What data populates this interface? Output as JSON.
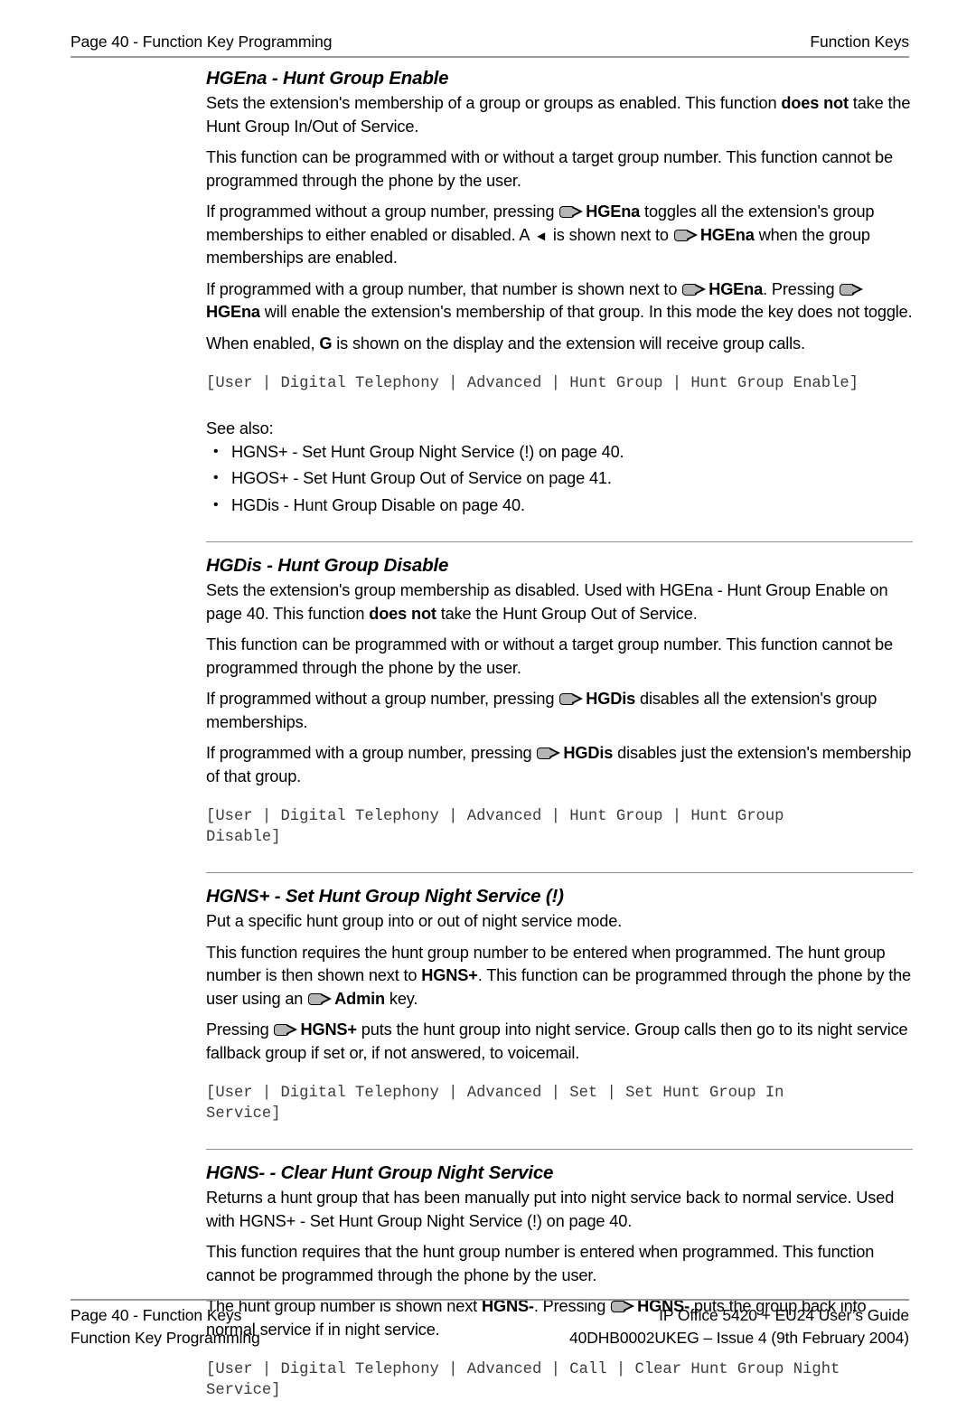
{
  "header": {
    "left": "Page 40 - Function Key Programming",
    "right": "Function Keys"
  },
  "sections": [
    {
      "title": "HGEna - Hunt Group Enable",
      "paras": [
        {
          "runs": [
            {
              "t": "Sets the extension's membership of a group or groups as enabled. This function "
            },
            {
              "t": "does not",
              "bold": true
            },
            {
              "t": " take the Hunt Group In/Out of Service."
            }
          ]
        },
        {
          "runs": [
            {
              "t": "This function can be programmed with or without a target group number. This function cannot be programmed through the phone by the user."
            }
          ]
        },
        {
          "runs": [
            {
              "t": "If programmed without a group number, pressing "
            },
            {
              "icon": "phone-key-icon"
            },
            {
              "t": "HGEna",
              "bold": true
            },
            {
              "t": " toggles all the extension's group memberships to either enabled or disabled. A "
            },
            {
              "icon": "left-triangle-icon"
            },
            {
              "t": " is shown next to "
            },
            {
              "icon": "phone-key-icon"
            },
            {
              "t": "HGEna",
              "bold": true
            },
            {
              "t": " when the group memberships are enabled."
            }
          ]
        },
        {
          "runs": [
            {
              "t": "If programmed with a group number, that number is shown next to "
            },
            {
              "icon": "phone-key-icon"
            },
            {
              "t": "HGEna",
              "bold": true
            },
            {
              "t": ". Pressing "
            },
            {
              "icon": "phone-key-icon"
            },
            {
              "t": "HGEna",
              "bold": true
            },
            {
              "t": " will enable the extension's membership of that group. In this mode the key does not toggle."
            }
          ]
        },
        {
          "runs": [
            {
              "t": "When enabled, "
            },
            {
              "t": "G",
              "bold": true
            },
            {
              "t": " is shown on the display and the extension will receive group calls."
            }
          ]
        }
      ],
      "path": "[User | Digital Telephony | Advanced | Hunt Group | Hunt Group Enable]",
      "see_also_label": "See also:",
      "see_also": [
        "HGNS+ - Set Hunt Group Night Service (!) on page 40.",
        "HGOS+ - Set Hunt Group Out of Service on page 41.",
        "HGDis - Hunt Group Disable on page 40."
      ]
    },
    {
      "title": "HGDis - Hunt Group Disable",
      "paras": [
        {
          "runs": [
            {
              "t": "Sets the extension's group membership as disabled. Used with HGEna - Hunt Group Enable on page 40. This function "
            },
            {
              "t": "does not",
              "bold": true
            },
            {
              "t": " take the Hunt Group Out of Service."
            }
          ]
        },
        {
          "runs": [
            {
              "t": "This function can be programmed with or without a target group number. This function cannot be programmed through the phone by the user."
            }
          ]
        },
        {
          "runs": [
            {
              "t": "If programmed without a group number, pressing "
            },
            {
              "icon": "phone-key-icon"
            },
            {
              "t": "HGDis",
              "bold": true
            },
            {
              "t": " disables all the extension's group memberships."
            }
          ]
        },
        {
          "runs": [
            {
              "t": "If programmed with a group number, pressing "
            },
            {
              "icon": "phone-key-icon"
            },
            {
              "t": "HGDis",
              "bold": true
            },
            {
              "t": " disables just the extension's membership of that group."
            }
          ]
        }
      ],
      "path": "[User | Digital Telephony | Advanced | Hunt Group | Hunt Group\nDisable]"
    },
    {
      "title": "HGNS+ - Set Hunt Group Night Service (!)",
      "paras": [
        {
          "runs": [
            {
              "t": "Put a specific hunt group into or out of night service mode."
            }
          ]
        },
        {
          "runs": [
            {
              "t": "This function requires the hunt group number to be entered when programmed. The hunt group number is then shown next to "
            },
            {
              "t": "HGNS+",
              "bold": true
            },
            {
              "t": ". This function can be programmed through the phone by the user using an "
            },
            {
              "icon": "phone-key-icon"
            },
            {
              "t": "Admin",
              "bold": true
            },
            {
              "t": " key."
            }
          ]
        },
        {
          "runs": [
            {
              "t": "Pressing "
            },
            {
              "icon": "phone-key-icon"
            },
            {
              "t": "HGNS+",
              "bold": true
            },
            {
              "t": " puts the hunt group into night service. Group calls then go to its night service fallback group if set or, if not answered, to voicemail."
            }
          ]
        }
      ],
      "path": "[User | Digital Telephony | Advanced | Set | Set Hunt Group In\nService]"
    },
    {
      "title": "HGNS- - Clear Hunt Group Night Service",
      "paras": [
        {
          "runs": [
            {
              "t": "Returns a hunt group that has been manually put into night service back to normal service. Used with HGNS+ - Set Hunt Group Night Service (!) on page 40."
            }
          ]
        },
        {
          "runs": [
            {
              "t": "This function requires that the hunt group number is entered when programmed. This function cannot be programmed through the phone by the user."
            }
          ]
        },
        {
          "runs": [
            {
              "t": "The hunt group number is shown next "
            },
            {
              "t": "HGNS-",
              "bold": true
            },
            {
              "t": ". Pressing "
            },
            {
              "icon": "phone-key-icon"
            },
            {
              "t": "HGNS-",
              "bold": true
            },
            {
              "t": " puts the group back into normal service if in night service."
            }
          ]
        }
      ],
      "path": "[User | Digital Telephony | Advanced | Call | Clear Hunt Group Night\nService]"
    }
  ],
  "footer": {
    "left_line1": "Page 40 - Function Keys",
    "left_line2": "Function Key Programming",
    "right_line1": "IP Office 5420 + EU24 User’s Guide",
    "right_line2": "40DHB0002UKEG – Issue 4 (9th February 2004)"
  },
  "icons": {
    "phone_key": "phone-key-icon",
    "left_triangle": "◄"
  }
}
